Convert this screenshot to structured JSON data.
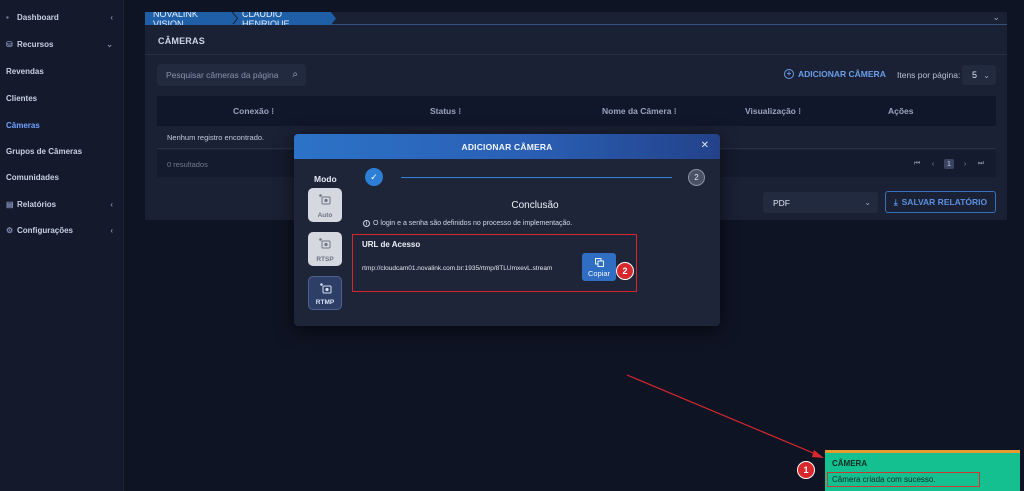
{
  "sidebar": {
    "items": [
      {
        "label": "Dashboard",
        "icon": "dashboard-icon",
        "has_chevron": true
      },
      {
        "label": "Recursos",
        "icon": "resources-icon",
        "has_chevron": true
      },
      {
        "label": "Revendas"
      },
      {
        "label": "Clientes"
      },
      {
        "label": "Câmeras",
        "active": true
      },
      {
        "label": "Grupos de Câmeras"
      },
      {
        "label": "Comunidades"
      },
      {
        "label": "Relatórios",
        "icon": "reports-icon",
        "has_chevron": true
      },
      {
        "label": "Configurações",
        "icon": "settings-icon",
        "has_chevron": true
      }
    ]
  },
  "breadcrumb": {
    "items": [
      "NOVALINK VISION",
      "CLAUDIO HENRIQUE"
    ]
  },
  "page": {
    "title": "CÂMERAS"
  },
  "search": {
    "placeholder": "Pesquisar câmeras da página"
  },
  "toolbar": {
    "add_camera": "ADICIONAR CÂMERA",
    "per_page_label": "Itens por página:",
    "per_page_value": "5"
  },
  "table": {
    "columns": [
      "Conexão",
      "Status",
      "Nome da Câmera",
      "Visualização",
      "Ações"
    ],
    "empty_text": "Nenhum registro encontrado.",
    "results": "0 resultados",
    "current_page": "1"
  },
  "report": {
    "format": "PDF",
    "save_label": "SALVAR RELATÓRIO"
  },
  "modal": {
    "title": "ADICIONAR CÂMERA",
    "mode_label": "Modo",
    "modes": [
      "Auto",
      "RTSP",
      "RTMP"
    ],
    "selected_mode": "RTMP",
    "step2": "2",
    "heading": "Conclusão",
    "info": "O login e a senha são definidos no processo de implementação.",
    "url_label": "URL de Acesso",
    "url_value": "rtmp://cloudcam01.novalink.com.br:1935/rtmp/8TLUmxevL.stream",
    "copy_label": "Copiar"
  },
  "annotations": {
    "badge1": "1",
    "badge2": "2",
    "color": "#d7282d"
  },
  "toast": {
    "title": "CÂMERA",
    "message": "Câmera criada com sucesso.",
    "color": "#14c08f"
  }
}
